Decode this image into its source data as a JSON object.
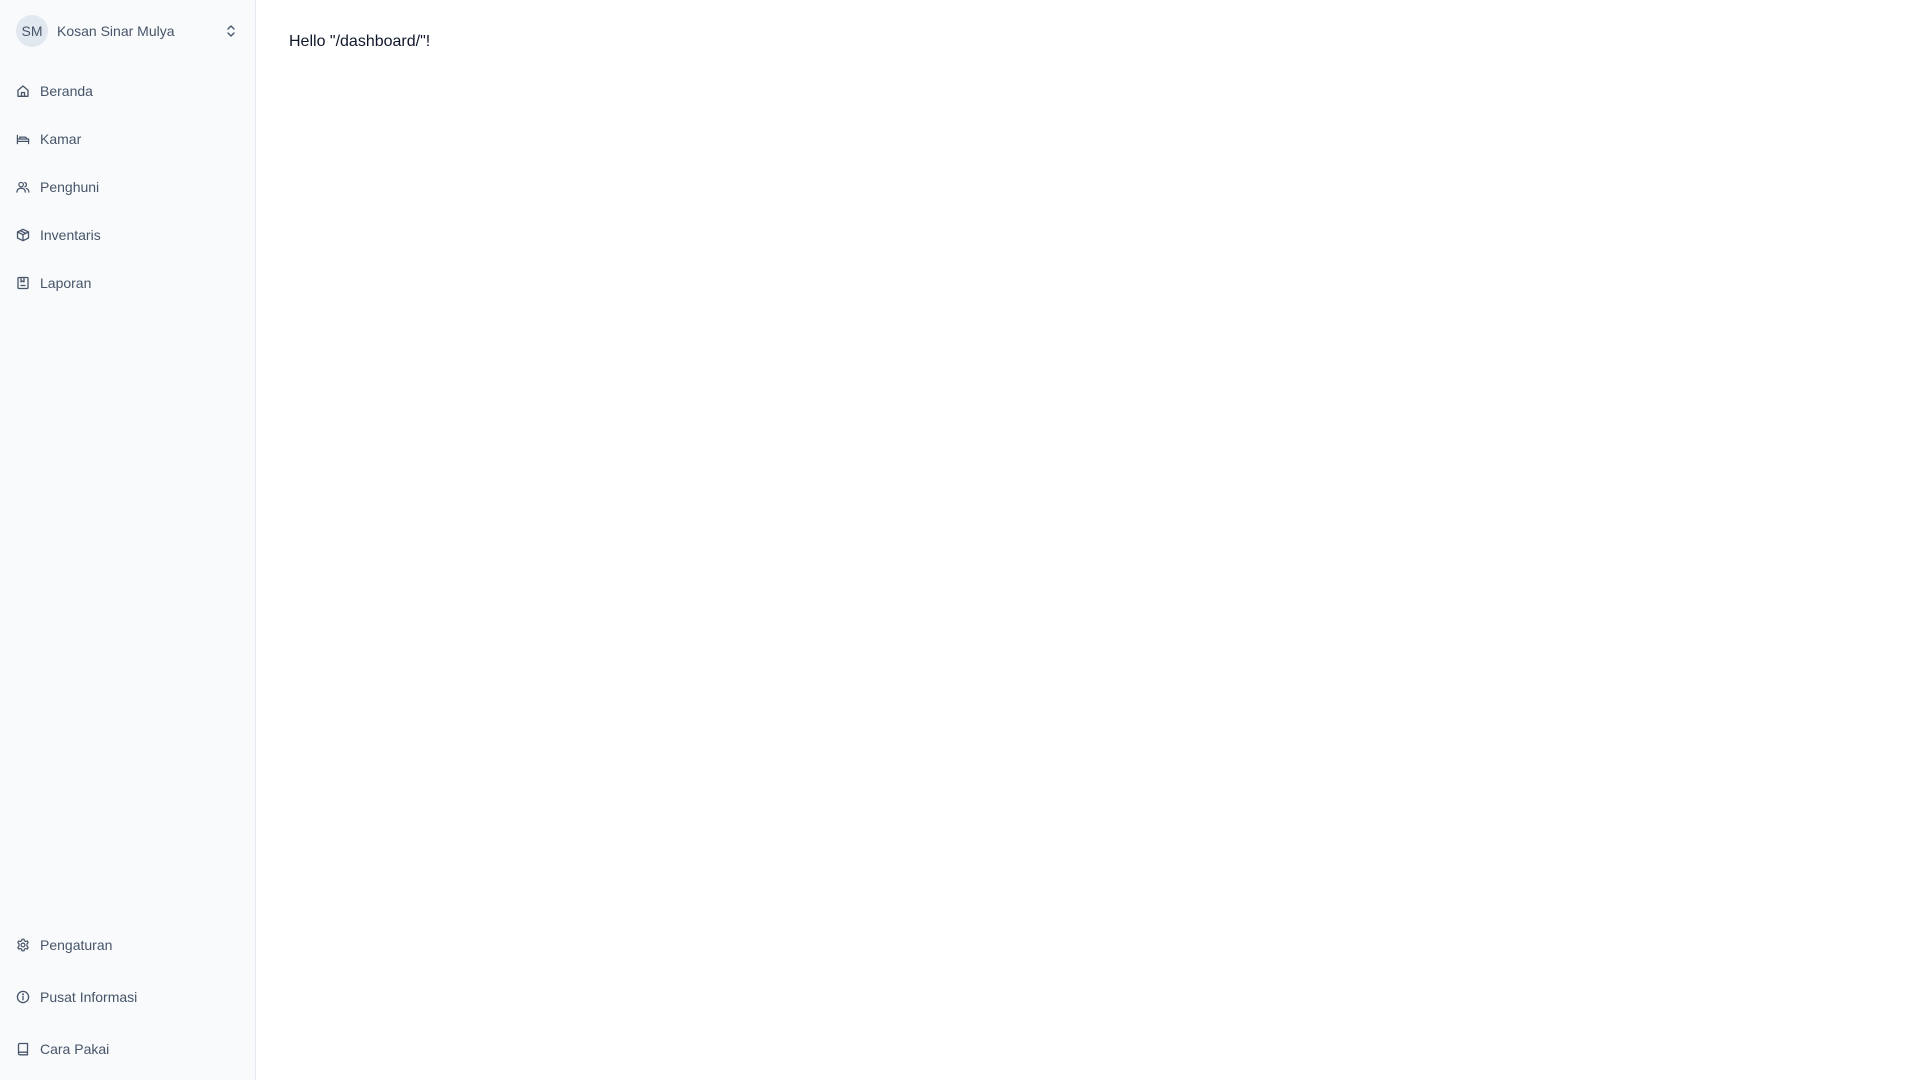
{
  "org": {
    "initials": "SM",
    "name": "Kosan Sinar Mulya"
  },
  "nav": {
    "items": [
      {
        "label": "Beranda",
        "icon": "home-icon"
      },
      {
        "label": "Kamar",
        "icon": "bed-icon"
      },
      {
        "label": "Penghuni",
        "icon": "users-icon"
      },
      {
        "label": "Inventaris",
        "icon": "package-icon"
      },
      {
        "label": "Laporan",
        "icon": "report-icon"
      }
    ]
  },
  "bottom_nav": {
    "items": [
      {
        "label": "Pengaturan",
        "icon": "gear-icon"
      },
      {
        "label": "Pusat Informasi",
        "icon": "info-icon"
      },
      {
        "label": "Cara Pakai",
        "icon": "book-icon"
      }
    ]
  },
  "main": {
    "greeting": "Hello \"/dashboard/\"!"
  },
  "colors": {
    "sidebar_bg": "#f8fafc",
    "text_muted": "#475569",
    "border": "#e2e8f0"
  }
}
